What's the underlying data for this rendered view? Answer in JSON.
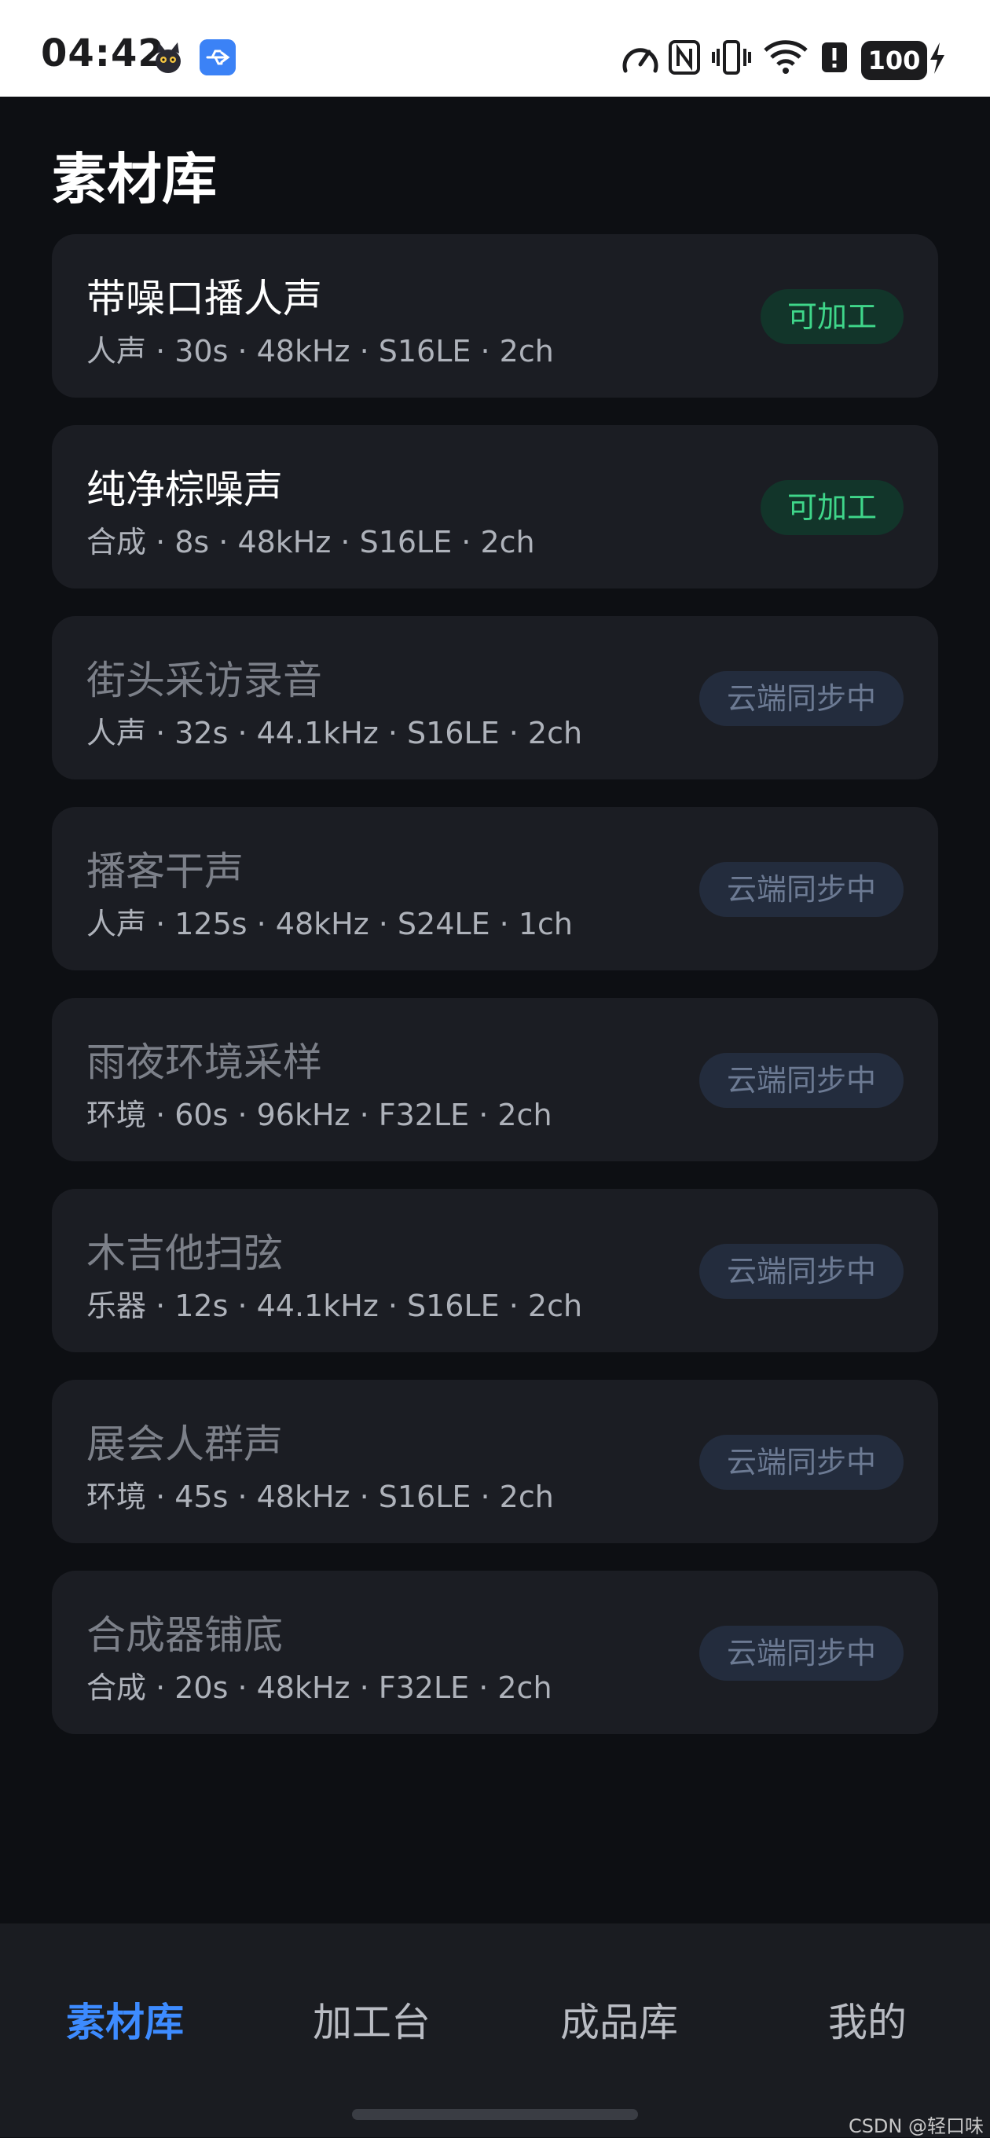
{
  "status_bar": {
    "time": "04:42",
    "battery": "100",
    "icons": [
      "cat-avatar-icon",
      "usb-icon",
      "speed-icon",
      "nfc-icon",
      "vibrate-icon",
      "wifi-icon",
      "alert-icon",
      "battery-icon",
      "charging-icon"
    ]
  },
  "page": {
    "title": "素材库"
  },
  "cards": [
    {
      "title": "带噪口播人声",
      "meta": "人声 · 30s · 48kHz · S16LE · 2ch",
      "status": "可加工",
      "state": "ready"
    },
    {
      "title": "纯净棕噪声",
      "meta": "合成 · 8s · 48kHz · S16LE · 2ch",
      "status": "可加工",
      "state": "ready"
    },
    {
      "title": "街头采访录音",
      "meta": "人声 · 32s · 44.1kHz · S16LE · 2ch",
      "status": "云端同步中",
      "state": "syncing"
    },
    {
      "title": "播客干声",
      "meta": "人声 · 125s · 48kHz · S24LE · 1ch",
      "status": "云端同步中",
      "state": "syncing"
    },
    {
      "title": "雨夜环境采样",
      "meta": "环境 · 60s · 96kHz · F32LE · 2ch",
      "status": "云端同步中",
      "state": "syncing"
    },
    {
      "title": "木吉他扫弦",
      "meta": "乐器 · 12s · 44.1kHz · S16LE · 2ch",
      "status": "云端同步中",
      "state": "syncing"
    },
    {
      "title": "展会人群声",
      "meta": "环境 · 45s · 48kHz · S16LE · 2ch",
      "status": "云端同步中",
      "state": "syncing"
    },
    {
      "title": "合成器铺底",
      "meta": "合成 · 20s · 48kHz · F32LE · 2ch",
      "status": "云端同步中",
      "state": "syncing"
    }
  ],
  "tabbar": {
    "tabs": [
      {
        "label": "素材库",
        "active": true
      },
      {
        "label": "加工台",
        "active": false
      },
      {
        "label": "成品库",
        "active": false
      },
      {
        "label": "我的",
        "active": false
      }
    ]
  },
  "watermark": "CSDN @轻口味",
  "colors": {
    "background": "#0d0f13",
    "card": "#1b1d23",
    "accent": "#3d8bff",
    "ready_text": "#3fd68a",
    "ready_bg": "#12352a",
    "sync_text": "#6c7a93",
    "sync_bg": "#232c3d"
  }
}
